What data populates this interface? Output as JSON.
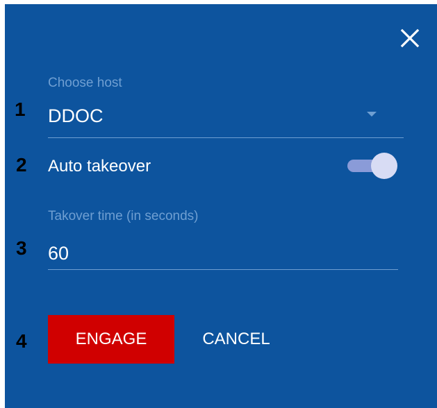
{
  "colors": {
    "dialog_background": "#0d549e",
    "label_color": "#6f9fd2",
    "text_color": "#ffffff",
    "engage_button": "#d00000",
    "toggle_track": "#8a9bd8",
    "toggle_knob": "#d8dcf4",
    "step_number_color": "#000000"
  },
  "dialog": {
    "close_icon": "close-icon"
  },
  "step_numbers": [
    "1",
    "2",
    "3",
    "4"
  ],
  "host": {
    "label": "Choose host",
    "value": "DDOC",
    "dropdown_icon": "chevron-down-icon"
  },
  "auto_takeover": {
    "label": "Auto takeover",
    "enabled": true
  },
  "takeover_time": {
    "label": "Takover time (in seconds)",
    "value": "60"
  },
  "actions": {
    "engage_label": "ENGAGE",
    "cancel_label": "CANCEL"
  }
}
